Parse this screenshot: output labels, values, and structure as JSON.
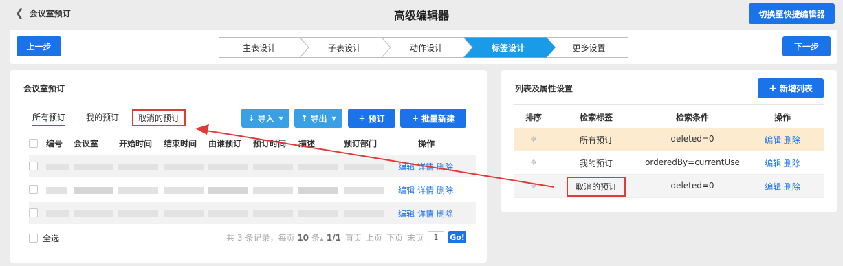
{
  "header": {
    "back_label": "会议室预订",
    "title": "高级编辑器",
    "switch_label": "切换至快捷编辑器"
  },
  "stepbar": {
    "prev_label": "上一步",
    "next_label": "下一步",
    "steps": [
      "主表设计",
      "子表设计",
      "动作设计",
      "标签设计",
      "更多设置"
    ],
    "active_step": 3
  },
  "left": {
    "title": "会议室预订",
    "tabs": [
      "所有预订",
      "我的预订",
      "取消的预订"
    ],
    "buttons": {
      "import": "导入",
      "export": "导出",
      "book": "预订",
      "batch": "批量新建"
    },
    "columns": [
      "编号",
      "会议室",
      "开始时间",
      "结束时间",
      "由谁预订",
      "预订时间",
      "描述",
      "预订部门",
      "操作"
    ],
    "row_ops": [
      "编辑",
      "详情",
      "删除"
    ],
    "footer": {
      "select_all": "全选",
      "summary_prefix": "共",
      "total": "3",
      "summary_mid": "条记录，每页",
      "per_page": "10",
      "summary_suffix": "条",
      "page_info": "1/1",
      "first": "首页",
      "prev": "上页",
      "next": "下页",
      "last": "末页",
      "page_input": "1",
      "go": "Go!"
    }
  },
  "right": {
    "title": "列表及属性设置",
    "add_label": "新增列表",
    "columns": [
      "排序",
      "检索标签",
      "检索条件",
      "操作"
    ],
    "rows": [
      {
        "label": "所有预订",
        "condition": "deleted=0",
        "edit": "编辑",
        "del": "删除"
      },
      {
        "label": "我的预订",
        "condition": "orderedBy=currentUse",
        "edit": "编辑",
        "del": "删除"
      },
      {
        "label": "取消的预订",
        "condition": "deleted=0",
        "edit": "编辑",
        "del": "删除"
      }
    ]
  },
  "colors": {
    "primary": "#1a73e8",
    "light_button": "#3aa0e6",
    "highlight_row": "#fdebd0",
    "annotation": "#e03a3a"
  }
}
